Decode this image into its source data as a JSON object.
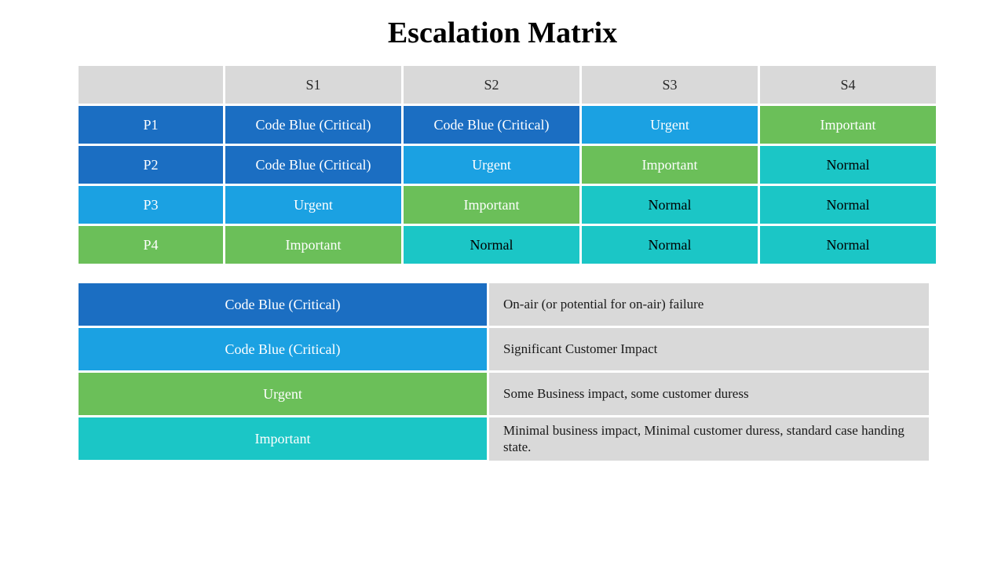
{
  "title": "Escalation Matrix",
  "colors": {
    "header": "#d9d9d9",
    "dark_blue": "#1b6ec2",
    "light_blue": "#1ba1e2",
    "green": "#6bbf59",
    "teal": "#1bc6c6"
  },
  "chart_data": {
    "type": "table",
    "columns": [
      "",
      "S1",
      "S2",
      "S3",
      "S4"
    ],
    "rows": [
      {
        "label": "P1",
        "cells": [
          "Code Blue (Critical)",
          "Code Blue (Critical)",
          "Urgent",
          "Important"
        ]
      },
      {
        "label": "P2",
        "cells": [
          "Code Blue (Critical)",
          "Urgent",
          "Important",
          "Normal"
        ]
      },
      {
        "label": "P3",
        "cells": [
          "Urgent",
          "Important",
          "Normal",
          "Normal"
        ]
      },
      {
        "label": "P4",
        "cells": [
          "Important",
          "Normal",
          "Normal",
          "Normal"
        ]
      }
    ],
    "legend": [
      {
        "label": "Code Blue (Critical)",
        "description": "On-air (or potential for on-air) failure",
        "color": "dark_blue"
      },
      {
        "label": "Code Blue (Critical)",
        "description": "Significant Customer Impact",
        "color": "light_blue"
      },
      {
        "label": "Urgent",
        "description": "Some Business impact, some customer duress",
        "color": "green"
      },
      {
        "label": "Important",
        "description": "Minimal business impact, Minimal customer duress, standard case handing state.",
        "color": "teal"
      }
    ]
  },
  "matrix_headers": {
    "s1": "S1",
    "s2": "S2",
    "s3": "S3",
    "s4": "S4"
  },
  "matrix_rows": {
    "p1": {
      "label": "P1",
      "c1": "Code Blue (Critical)",
      "c2": "Code Blue (Critical)",
      "c3": "Urgent",
      "c4": "Important"
    },
    "p2": {
      "label": "P2",
      "c1": "Code Blue (Critical)",
      "c2": "Urgent",
      "c3": "Important",
      "c4": "Normal"
    },
    "p3": {
      "label": "P3",
      "c1": "Urgent",
      "c2": "Important",
      "c3": "Normal",
      "c4": "Normal"
    },
    "p4": {
      "label": "P4",
      "c1": "Important",
      "c2": "Normal",
      "c3": "Normal",
      "c4": "Normal"
    }
  },
  "legend_rows": {
    "r1": {
      "label": "Code Blue (Critical)",
      "desc": "On-air (or potential for on-air) failure"
    },
    "r2": {
      "label": "Code Blue (Critical)",
      "desc": "Significant Customer Impact"
    },
    "r3": {
      "label": "Urgent",
      "desc": "Some Business impact, some customer duress"
    },
    "r4": {
      "label": "Important",
      "desc": "Minimal business impact, Minimal customer duress, standard case handing state."
    }
  }
}
